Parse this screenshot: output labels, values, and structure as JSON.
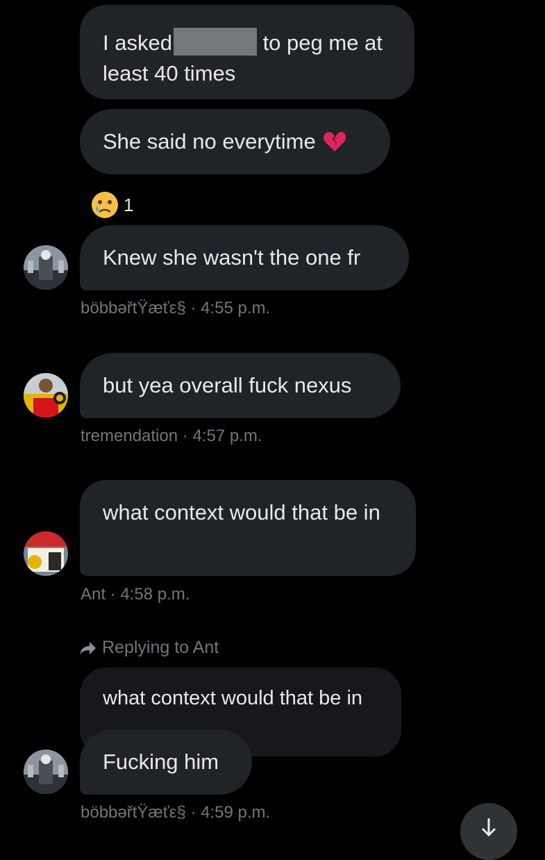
{
  "messages": [
    {
      "text_before": "I asked",
      "text_after": "to peg me at least 40 times",
      "redacted": true
    },
    {
      "text": "She said no everytime",
      "emoji": "broken-heart"
    },
    {
      "reaction": {
        "emoji": "crying-face",
        "count": "1"
      }
    },
    {
      "text": "Knew she wasn't the one fr",
      "author": "böbbəřtŸæťε§",
      "time": "4:55 p.m."
    },
    {
      "text": "but yea overall fuck nexus",
      "author": "tremendation",
      "time": "4:57 p.m."
    },
    {
      "text": "what context would that be in",
      "author": "Ant",
      "time": "4:58 p.m."
    }
  ],
  "reply": {
    "label": "Replying to Ant",
    "quoted_text": "what context would that be in",
    "text": "Fucking him",
    "author": "böbbəřtŸæťε§",
    "time": "4:59 p.m."
  },
  "colors": {
    "background": "#000000",
    "bubble": "#202327",
    "meta": "#71767b"
  },
  "icons": {
    "reply": "reply-arrow-icon",
    "scroll": "arrow-down-icon"
  }
}
